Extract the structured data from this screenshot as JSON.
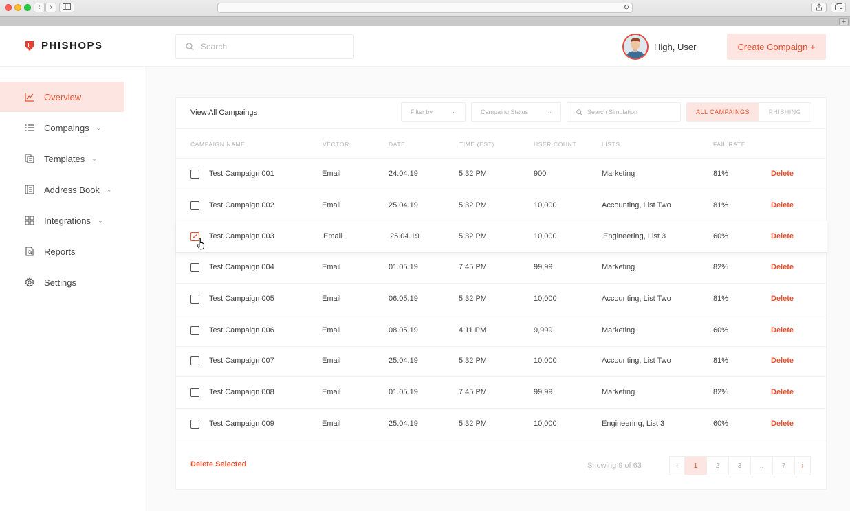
{
  "app": {
    "brand": "PHISHOPS",
    "accent": "#e8502f"
  },
  "header": {
    "search_placeholder": "Search",
    "user_greeting": "High, User",
    "create_button": "Create Compaign +"
  },
  "sidebar": {
    "items": [
      {
        "label": "Overview",
        "icon": "chart-line-icon",
        "active": true
      },
      {
        "label": "Compaings",
        "icon": "list-icon",
        "has_chevron": true
      },
      {
        "label": "Templates",
        "icon": "documents-icon",
        "has_chevron": true
      },
      {
        "label": "Address Book",
        "icon": "address-book-icon",
        "has_chevron": true
      },
      {
        "label": "Integrations",
        "icon": "grid-icon",
        "has_chevron": true
      },
      {
        "label": "Reports",
        "icon": "report-icon"
      },
      {
        "label": "Settings",
        "icon": "gear-icon"
      }
    ]
  },
  "table": {
    "title": "View All Campaings",
    "filter_by": "Filter by",
    "status_filter": "Campaing Status",
    "search_placeholder": "Search Simulation",
    "tabs": [
      "ALL CAMPAINGS",
      "PHISHING"
    ],
    "columns": [
      "CAMPAIGN NAME",
      "VECTOR",
      "DATE",
      "TIME (EST)",
      "USER COUNT",
      "LISTS",
      "FAIL RATE"
    ],
    "rows": [
      {
        "name": "Test Campaign 001",
        "vector": "Email",
        "date": "24.04.19",
        "time": "5:32 PM",
        "count": "900",
        "lists": "Marketing",
        "fail": "81%",
        "action": "Delete",
        "checked": false
      },
      {
        "name": "Test Campaign 002",
        "vector": "Email",
        "date": "25.04.19",
        "time": "5:32 PM",
        "count": "10,000",
        "lists": "Accounting, List Two",
        "fail": "81%",
        "action": "Delete",
        "checked": false
      },
      {
        "name": "Test Campaign 003",
        "vector": "Email",
        "date": "25.04.19",
        "time": "5:32 PM",
        "count": "10,000",
        "lists": "Engineering, List 3",
        "fail": "60%",
        "action": "Delete",
        "checked": true
      },
      {
        "name": "Test Campaign 004",
        "vector": "Email",
        "date": "01.05.19",
        "time": "7:45 PM",
        "count": "99,99",
        "lists": "Marketing",
        "fail": "82%",
        "action": "Delete",
        "checked": false
      },
      {
        "name": "Test Campaign 005",
        "vector": "Email",
        "date": "06.05.19",
        "time": "5:32 PM",
        "count": "10,000",
        "lists": "Accounting, List Two",
        "fail": "81%",
        "action": "Delete",
        "checked": false
      },
      {
        "name": "Test Campaign 006",
        "vector": "Email",
        "date": "08.05.19",
        "time": "4:11 PM",
        "count": "9,999",
        "lists": "Marketing",
        "fail": "60%",
        "action": "Delete",
        "checked": false
      },
      {
        "name": "Test Campaign 007",
        "vector": "Email",
        "date": "25.04.19",
        "time": "5:32 PM",
        "count": "10,000",
        "lists": "Accounting, List Two",
        "fail": "81%",
        "action": "Delete",
        "checked": false
      },
      {
        "name": "Test Campaign 008",
        "vector": "Email",
        "date": "01.05.19",
        "time": "7:45 PM",
        "count": "99,99",
        "lists": "Marketing",
        "fail": "82%",
        "action": "Delete",
        "checked": false
      },
      {
        "name": "Test Campaign 009",
        "vector": "Email",
        "date": "25.04.19",
        "time": "5:32 PM",
        "count": "10,000",
        "lists": "Engineering, List 3",
        "fail": "60%",
        "action": "Delete",
        "checked": false
      }
    ],
    "delete_selected": "Delete Selected",
    "showing": "Showing 9 of 63",
    "pages": [
      "1",
      "2",
      "3",
      "..",
      "7"
    ],
    "current_page": "1"
  }
}
